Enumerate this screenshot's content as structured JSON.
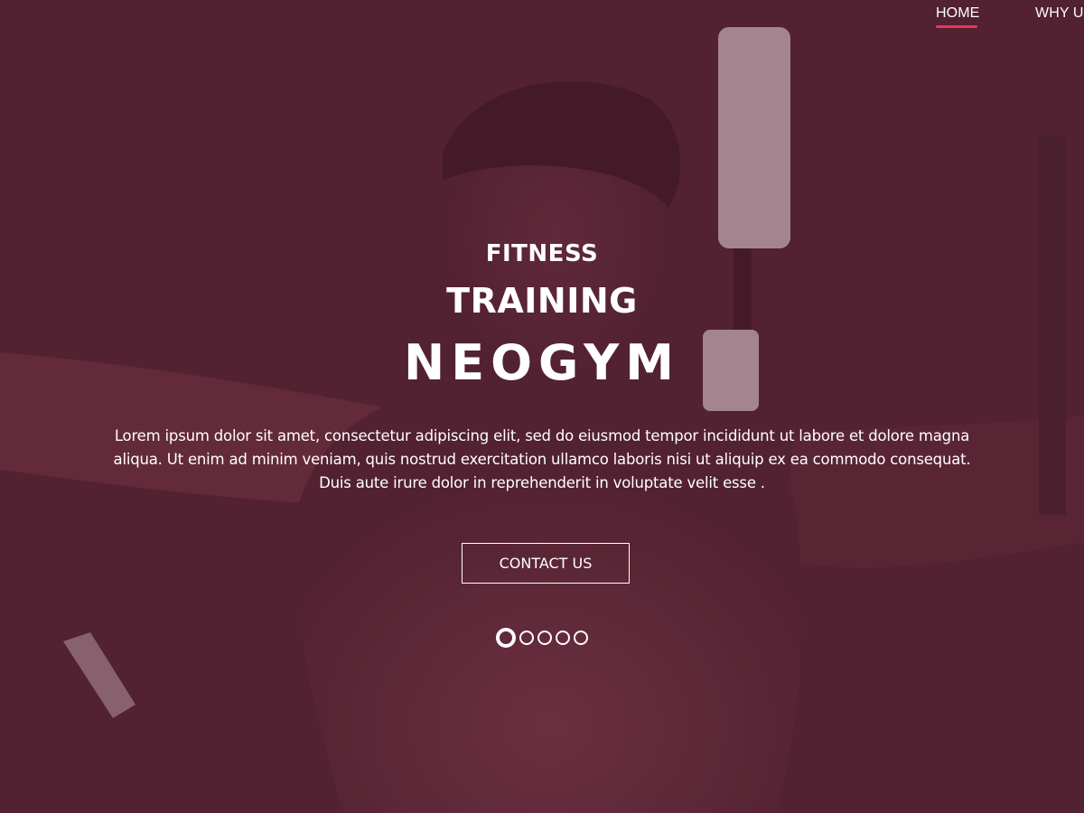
{
  "colors": {
    "background": "#532433",
    "accent": "#e8365d",
    "text": "#ffffff"
  },
  "nav": {
    "items": [
      {
        "label": "HOME",
        "active": true
      },
      {
        "label": "WHY US",
        "active": false
      }
    ]
  },
  "hero": {
    "line1": "FITNESS",
    "line2": "TRAINING",
    "line3": "NEOGYM",
    "description": "Lorem ipsum dolor sit amet, consectetur adipiscing elit, sed do eiusmod tempor incididunt ut labore et dolore magna aliqua. Ut enim ad minim veniam, quis nostrud exercitation ullamco laboris nisi ut aliquip ex ea commodo consequat. Duis aute irure dolor in reprehenderit in voluptate velit esse .",
    "cta_label": "CONTACT US"
  },
  "slider": {
    "total": 5,
    "active_index": 0
  }
}
